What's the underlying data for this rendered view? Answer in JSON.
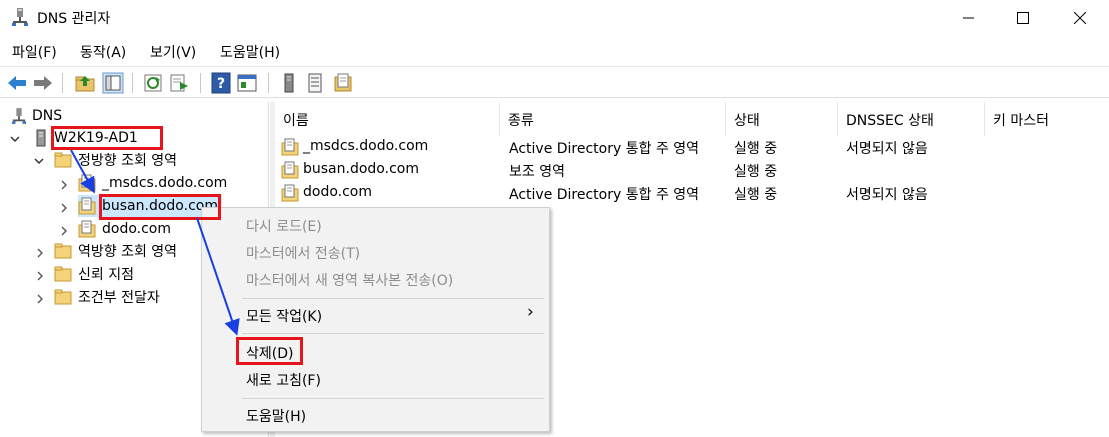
{
  "window": {
    "title": "DNS 관리자",
    "controls": {
      "minimize": "minimize",
      "maximize": "maximize",
      "close": "close"
    }
  },
  "menubar": {
    "items": [
      "파일(F)",
      "동작(A)",
      "보기(V)",
      "도움말(H)"
    ]
  },
  "toolbar": {
    "buttons": [
      "back-arrow-icon",
      "forward-arrow-icon",
      "up-folder-icon",
      "show-hide-tree-icon",
      "refresh-icon",
      "export-list-icon",
      "help-icon",
      "properties-icon",
      "server-icon",
      "list-icon",
      "zone-icon"
    ]
  },
  "tree": {
    "root": "DNS",
    "server": "W2K19-AD1",
    "forward_zones": "정방향 조회 영역",
    "zones": [
      "_msdcs.dodo.com",
      "busan.dodo.com",
      "dodo.com"
    ],
    "reverse_zones": "역방향 조회 영역",
    "trust_points": "신뢰 지점",
    "conditional_forwarders": "조건부 전달자"
  },
  "list": {
    "columns": [
      "이름",
      "종류",
      "상태",
      "DNSSEC 상태",
      "키 마스터"
    ],
    "rows": [
      {
        "name": "_msdcs.dodo.com",
        "type": "Active Directory 통합 주 영역",
        "status": "실행 중",
        "dnssec": "서명되지 않음"
      },
      {
        "name": "busan.dodo.com",
        "type": "보조 영역",
        "status": "실행 중",
        "dnssec": ""
      },
      {
        "name": "dodo.com",
        "type": "Active Directory 통합 주 영역",
        "status": "실행 중",
        "dnssec": "서명되지 않음"
      }
    ]
  },
  "context_menu": {
    "reload": "다시 로드(E)",
    "transfer_from_master": "마스터에서 전송(T)",
    "transfer_new_copy": "마스터에서 새 영역 복사본 전송(O)",
    "all_tasks": "모든 작업(K)",
    "all_tasks_arrow": "›",
    "delete": "삭제(D)",
    "refresh": "새로 고침(F)",
    "help": "도움말(H)"
  },
  "colors": {
    "highlight_border": "#e8141b",
    "annotation_arrow": "#1a3fe0",
    "selected_row": "#cce8ff",
    "disabled_text": "#8d8d8d"
  }
}
